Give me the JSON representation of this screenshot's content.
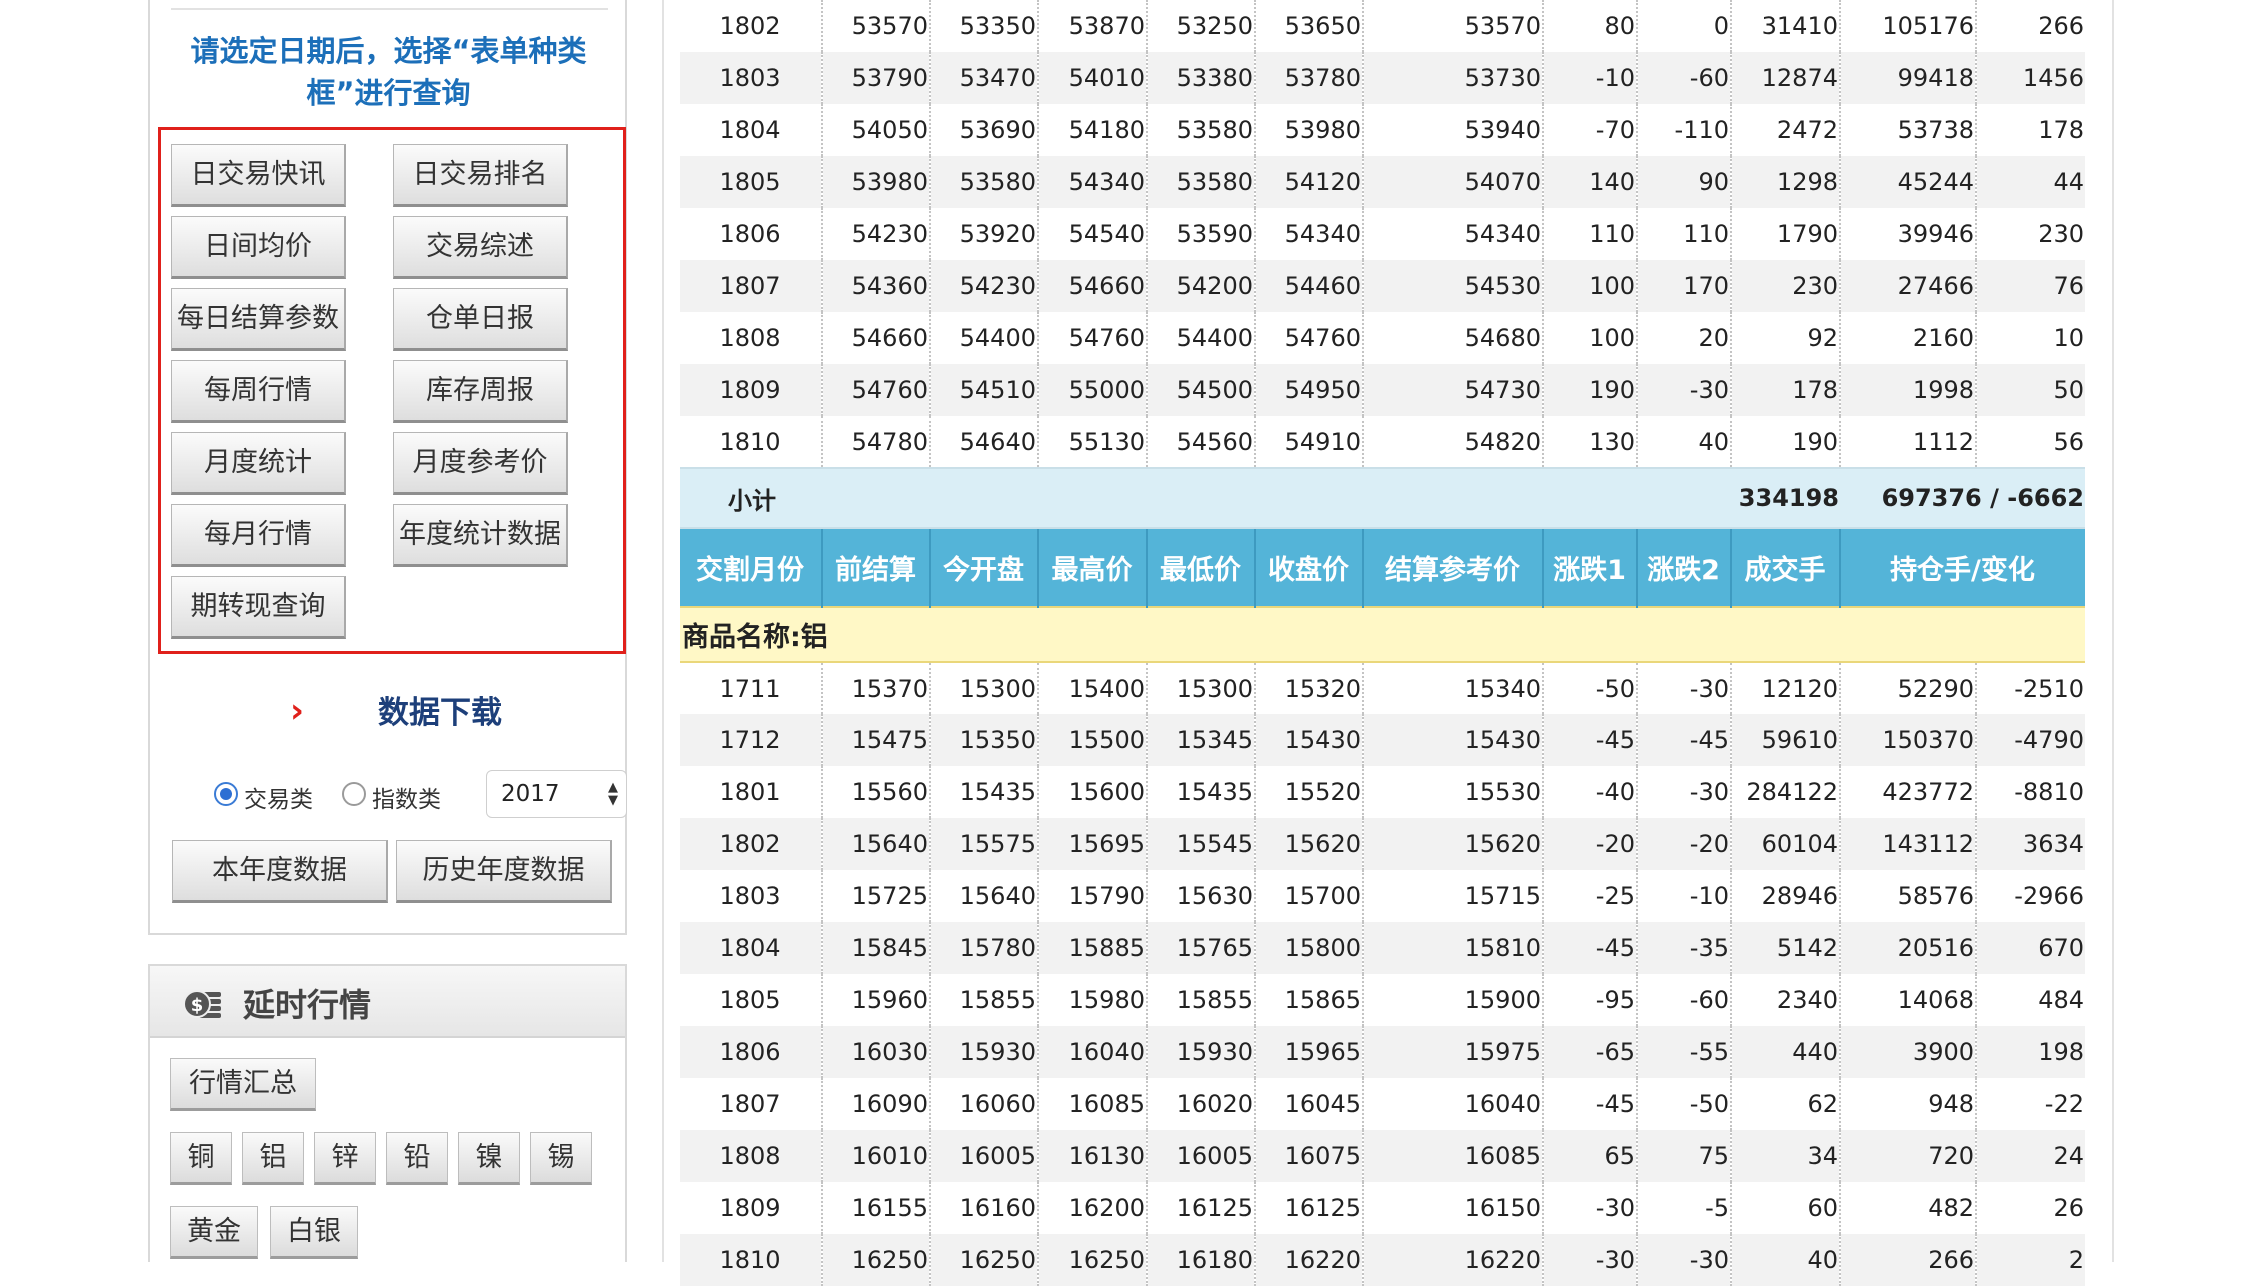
{
  "sidebar": {
    "hint": "请选定日期后，选择“表单种类框”进行查询",
    "report_buttons": [
      "日交易快讯",
      "日交易排名",
      "日间均价",
      "交易综述",
      "每日结算参数",
      "仓单日报",
      "每周行情",
      "库存周报",
      "月度统计",
      "月度参考价",
      "每月行情",
      "年度统计数据",
      "期转现查询"
    ],
    "download": {
      "title": "数据下载",
      "radio_trade": "交易类",
      "radio_index": "指数类",
      "year": "2017",
      "current_year_button": "本年度数据",
      "history_button": "历史年度数据"
    }
  },
  "delayed": {
    "title": "延时行情",
    "summary_button": "行情汇总",
    "metals": [
      "铜",
      "铝",
      "锌",
      "铅",
      "镍",
      "锡"
    ],
    "precious": [
      "黄金",
      "白银"
    ]
  },
  "table": {
    "headers": [
      "交割月份",
      "前结算",
      "今开盘",
      "最高价",
      "最低价",
      "收盘价",
      "结算参考价",
      "涨跌1",
      "涨跌2",
      "成交手",
      "持仓手/变化"
    ],
    "copper_rows": [
      [
        "1802",
        "53570",
        "53350",
        "53870",
        "53250",
        "53650",
        "53570",
        "80",
        "0",
        "31410",
        "105176",
        "266"
      ],
      [
        "1803",
        "53790",
        "53470",
        "54010",
        "53380",
        "53780",
        "53730",
        "-10",
        "-60",
        "12874",
        "99418",
        "1456"
      ],
      [
        "1804",
        "54050",
        "53690",
        "54180",
        "53580",
        "53980",
        "53940",
        "-70",
        "-110",
        "2472",
        "53738",
        "178"
      ],
      [
        "1805",
        "53980",
        "53580",
        "54340",
        "53580",
        "54120",
        "54070",
        "140",
        "90",
        "1298",
        "45244",
        "44"
      ],
      [
        "1806",
        "54230",
        "53920",
        "54540",
        "53590",
        "54340",
        "54340",
        "110",
        "110",
        "1790",
        "39946",
        "230"
      ],
      [
        "1807",
        "54360",
        "54230",
        "54660",
        "54200",
        "54460",
        "54530",
        "100",
        "170",
        "230",
        "27466",
        "76"
      ],
      [
        "1808",
        "54660",
        "54400",
        "54760",
        "54400",
        "54760",
        "54680",
        "100",
        "20",
        "92",
        "2160",
        "10"
      ],
      [
        "1809",
        "54760",
        "54510",
        "55000",
        "54500",
        "54950",
        "54730",
        "190",
        "-30",
        "178",
        "1998",
        "50"
      ],
      [
        "1810",
        "54780",
        "54640",
        "55130",
        "54560",
        "54910",
        "54820",
        "130",
        "40",
        "190",
        "1112",
        "56"
      ]
    ],
    "subtotal": {
      "label": "小计",
      "volume": "334198",
      "open_interest": "697376 / -6662"
    },
    "aluminum_title": "商品名称:铝",
    "aluminum_rows": [
      [
        "1711",
        "15370",
        "15300",
        "15400",
        "15300",
        "15320",
        "15340",
        "-50",
        "-30",
        "12120",
        "52290",
        "-2510"
      ],
      [
        "1712",
        "15475",
        "15350",
        "15500",
        "15345",
        "15430",
        "15430",
        "-45",
        "-45",
        "59610",
        "150370",
        "-4790"
      ],
      [
        "1801",
        "15560",
        "15435",
        "15600",
        "15435",
        "15520",
        "15530",
        "-40",
        "-30",
        "284122",
        "423772",
        "-8810"
      ],
      [
        "1802",
        "15640",
        "15575",
        "15695",
        "15545",
        "15620",
        "15620",
        "-20",
        "-20",
        "60104",
        "143112",
        "3634"
      ],
      [
        "1803",
        "15725",
        "15640",
        "15790",
        "15630",
        "15700",
        "15715",
        "-25",
        "-10",
        "28946",
        "58576",
        "-2966"
      ],
      [
        "1804",
        "15845",
        "15780",
        "15885",
        "15765",
        "15800",
        "15810",
        "-45",
        "-35",
        "5142",
        "20516",
        "670"
      ],
      [
        "1805",
        "15960",
        "15855",
        "15980",
        "15855",
        "15865",
        "15900",
        "-95",
        "-60",
        "2340",
        "14068",
        "484"
      ],
      [
        "1806",
        "16030",
        "15930",
        "16040",
        "15930",
        "15965",
        "15975",
        "-65",
        "-55",
        "440",
        "3900",
        "198"
      ],
      [
        "1807",
        "16090",
        "16060",
        "16085",
        "16020",
        "16045",
        "16040",
        "-45",
        "-50",
        "62",
        "948",
        "-22"
      ],
      [
        "1808",
        "16010",
        "16005",
        "16130",
        "16005",
        "16075",
        "16085",
        "65",
        "75",
        "34",
        "720",
        "24"
      ],
      [
        "1809",
        "16155",
        "16160",
        "16200",
        "16125",
        "16125",
        "16150",
        "-30",
        "-5",
        "60",
        "482",
        "26"
      ],
      [
        "1810",
        "16250",
        "16250",
        "16250",
        "16180",
        "16220",
        "16220",
        "-30",
        "-30",
        "40",
        "266",
        "2"
      ]
    ]
  }
}
